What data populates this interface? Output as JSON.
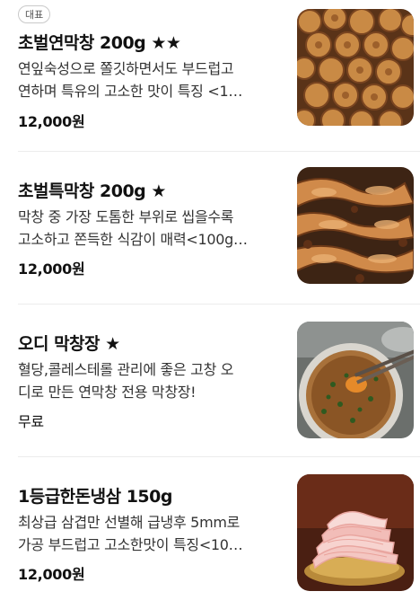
{
  "menu": {
    "items": [
      {
        "badge": "대표",
        "name": "초벌연막창 200g ★★",
        "desc_line1": "연잎숙성으로 쫄깃하면서도 부드럽고",
        "desc_line2": "연하며 특유의 고소한 맛이 특징 <1…",
        "price": "12,000원",
        "image_icon": "grilled-makchang-photo"
      },
      {
        "name": "초벌특막창 200g ★",
        "desc_line1": "막창 중 가장 도톰한 부위로 씹을수록",
        "desc_line2": "고소하고 쫀득한 식감이 매력<100g…",
        "price": "12,000원",
        "image_icon": "thick-makchang-photo"
      },
      {
        "name": "오디 막창장 ★",
        "desc_line1": "혈당,콜레스테롤 관리에 좋은 고창 오",
        "desc_line2": "디로 만든 연막창 전용 막창장!",
        "price": "무료",
        "image_icon": "dipping-sauce-photo"
      },
      {
        "name": "1등급한돈냉삼 150g",
        "desc_line1": "최상급 삼겹만 선별해 급냉후 5mm로",
        "desc_line2": "가공 부드럽고 고소한맛이 특징<10…",
        "price": "12,000원",
        "image_icon": "frozen-pork-belly-photo"
      }
    ]
  }
}
